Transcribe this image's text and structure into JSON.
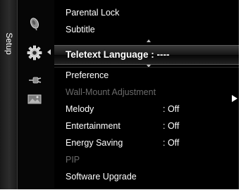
{
  "sidebar": {
    "tab_label": "Setup",
    "icons": [
      "satellite-dish-icon",
      "gear-icon",
      "input-plug-icon",
      "photo-icon"
    ]
  },
  "menu": {
    "items": [
      {
        "label": "Parental Lock",
        "value": ""
      },
      {
        "label": "Subtitle",
        "value": ""
      },
      {
        "label": "Teletext Language",
        "value": ": ----",
        "selected": true
      },
      {
        "label": "Preference",
        "value": ""
      },
      {
        "label": "Wall-Mount Adjustment",
        "value": "",
        "disabled": true
      },
      {
        "label": "Melody",
        "value": ": Off"
      },
      {
        "label": "Entertainment",
        "value": ": Off"
      },
      {
        "label": "Energy Saving",
        "value": ": Off"
      },
      {
        "label": "PIP",
        "value": "",
        "disabled": true
      },
      {
        "label": "Software Upgrade",
        "value": ""
      }
    ]
  },
  "colors": {
    "background": "#000000",
    "text": "#ffffff",
    "disabled_text": "#6a6a6a"
  }
}
